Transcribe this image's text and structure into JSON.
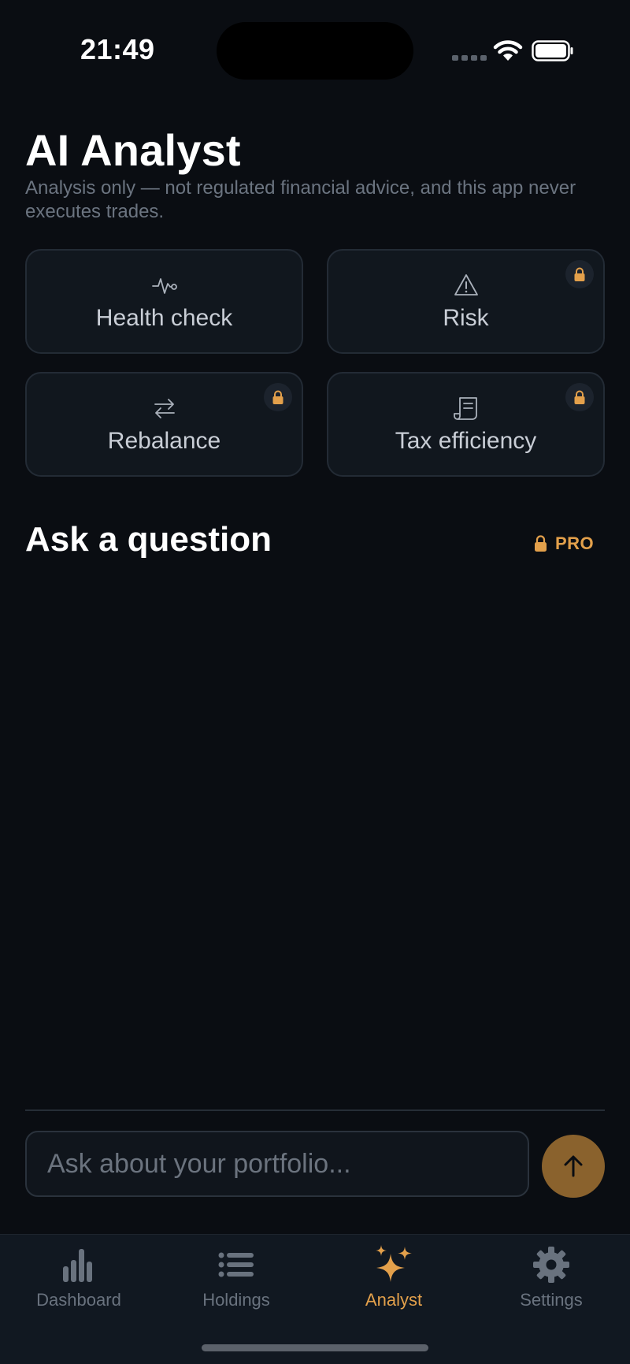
{
  "status_bar": {
    "time": "21:49"
  },
  "header": {
    "title": "AI Analyst",
    "disclaimer": "Analysis only — not regulated financial advice, and this app never executes trades."
  },
  "actions": [
    {
      "label": "Health check",
      "icon": "pulse-icon",
      "locked": false
    },
    {
      "label": "Risk",
      "icon": "warning-icon",
      "locked": true
    },
    {
      "label": "Rebalance",
      "icon": "swap-arrows-icon",
      "locked": true
    },
    {
      "label": "Tax efficiency",
      "icon": "receipt-icon",
      "locked": true
    }
  ],
  "ask": {
    "title": "Ask a question",
    "badge": "PRO",
    "input_placeholder": "Ask about your portfolio..."
  },
  "tabs": [
    {
      "label": "Dashboard",
      "icon": "bar-chart-icon",
      "active": false
    },
    {
      "label": "Holdings",
      "icon": "list-icon",
      "active": false
    },
    {
      "label": "Analyst",
      "icon": "sparkles-icon",
      "active": true
    },
    {
      "label": "Settings",
      "icon": "gear-icon",
      "active": false
    }
  ],
  "colors": {
    "background": "#0a0d12",
    "accent": "#e3a04b",
    "card": "#11171e",
    "muted_text": "#6b7480"
  }
}
